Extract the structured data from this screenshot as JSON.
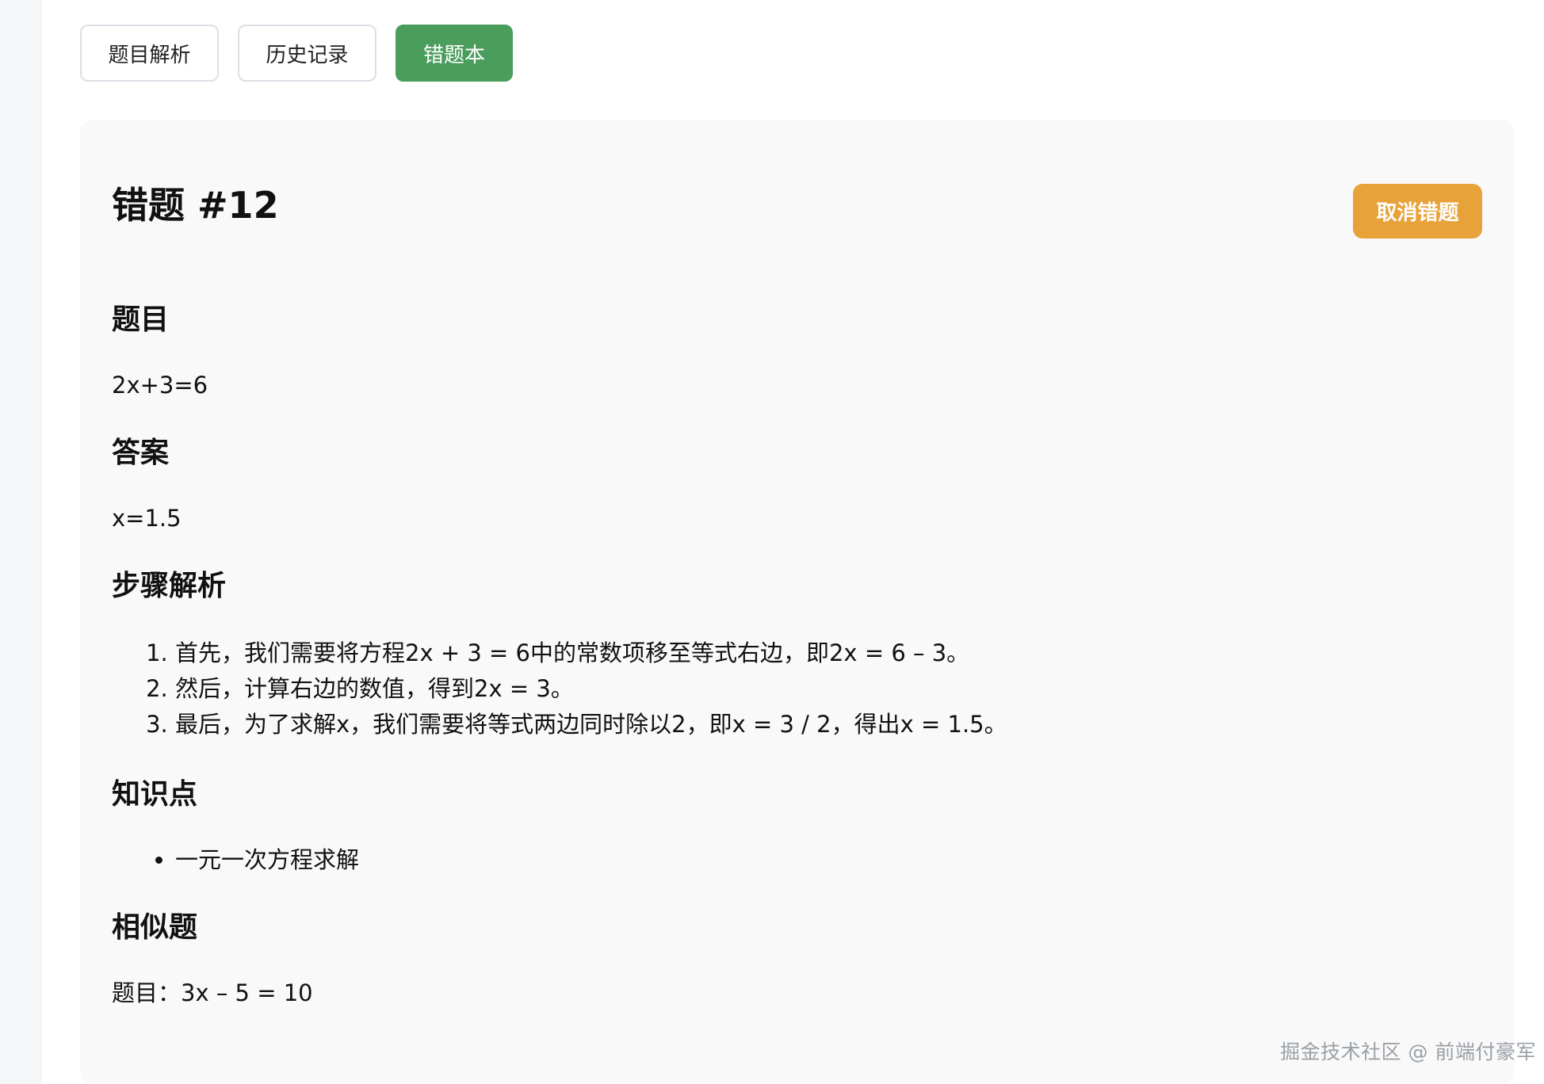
{
  "tabs": [
    {
      "label": "题目解析",
      "active": false
    },
    {
      "label": "历史记录",
      "active": false
    },
    {
      "label": "错题本",
      "active": true
    }
  ],
  "colors": {
    "accent_green": "#4a9d5b",
    "accent_orange": "#e8a23a"
  },
  "card": {
    "title": "错题 #12",
    "cancel_label": "取消错题",
    "question_heading": "题目",
    "question": "2x+3=6",
    "answer_heading": "答案",
    "answer": "x=1.5",
    "steps_heading": "步骤解析",
    "steps": [
      "首先，我们需要将方程2x + 3 = 6中的常数项移至等式右边，即2x = 6 – 3。",
      "然后，计算右边的数值，得到2x = 3。",
      "最后，为了求解x，我们需要将等式两边同时除以2，即x = 3 / 2，得出x = 1.5。"
    ],
    "knowledge_heading": "知识点",
    "knowledge_points": [
      "一元一次方程求解"
    ],
    "similar_heading": "相似题",
    "similar": "题目：3x – 5 = 10"
  },
  "watermark": "掘金技术社区 @ 前端付豪军"
}
